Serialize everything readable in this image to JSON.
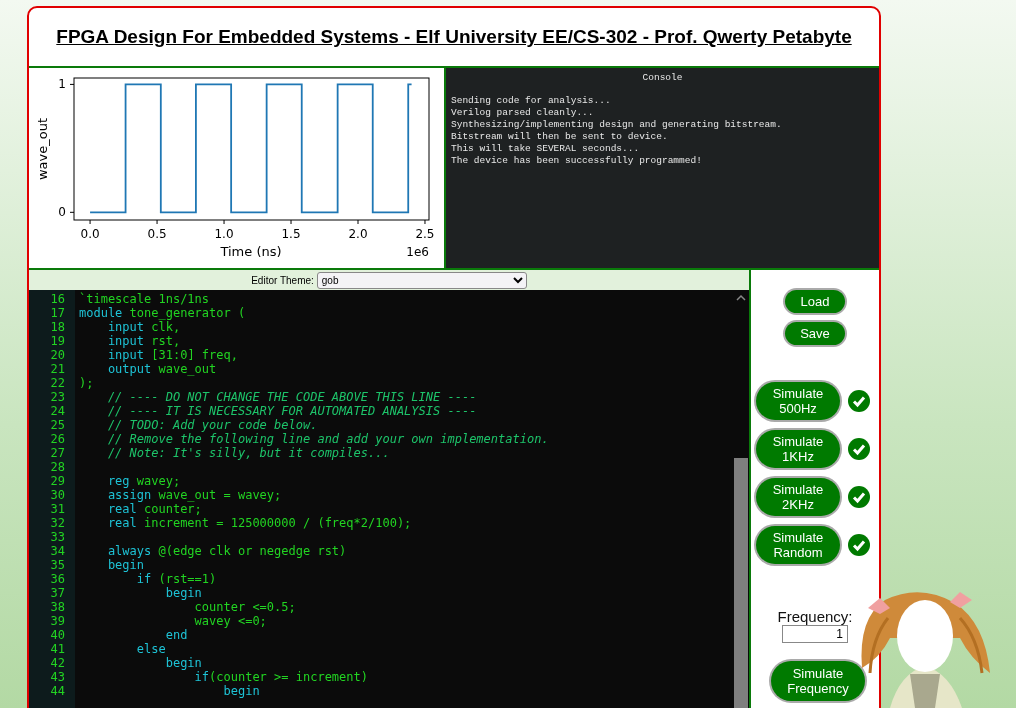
{
  "header": {
    "title": "FPGA Design For Embedded Systems - Elf University EE/CS-302 - Prof. Qwerty Petabyte"
  },
  "plot": {
    "chart_data": {
      "type": "line",
      "xlabel": "Time (ns)",
      "ylabel": "wave_out",
      "x": [
        0,
        0.265,
        0.265,
        0.528,
        0.528,
        0.79,
        0.79,
        1.053,
        1.053,
        1.318,
        1.318,
        1.58,
        1.58,
        1.848,
        1.848,
        2.11,
        2.11,
        2.375,
        2.375,
        2.4
      ],
      "series": [
        {
          "color": "#1f77b4",
          "values": [
            0,
            0,
            1,
            1,
            0,
            0,
            1,
            1,
            0,
            0,
            1,
            1,
            0,
            0,
            1,
            1,
            0,
            0,
            1,
            1
          ]
        }
      ],
      "xticks": [
        {
          "value": 0,
          "label": "0.0"
        },
        {
          "value": 0.5,
          "label": "0.5"
        },
        {
          "value": 1,
          "label": "1.0"
        },
        {
          "value": 1.5,
          "label": "1.5"
        },
        {
          "value": 2,
          "label": "2.0"
        },
        {
          "value": 2.5,
          "label": "2.5"
        }
      ],
      "yticks": [
        0,
        1
      ],
      "xlim": [
        -0.12,
        2.53
      ],
      "ylim": [
        -0.06,
        1.05
      ],
      "annotations": [
        "1e6"
      ]
    }
  },
  "console": {
    "title": "Console",
    "lines": [
      "Sending code for analysis...",
      "Verilog parsed cleanly...",
      "Synthesizing/implementing design and generating bitstream.",
      "Bitstream will then be sent to device.",
      "This will take SEVERAL seconds...",
      "The device has been successfully programmed!"
    ]
  },
  "editor": {
    "theme_label": "Editor Theme:",
    "theme": "gob",
    "lines": [
      {
        "number": "16",
        "segments": [
          {
            "kind": "plain",
            "text": "`timescale 1ns/1ns"
          }
        ]
      },
      {
        "number": "17",
        "segments": [
          {
            "kind": "keyword",
            "text": "module"
          },
          {
            "kind": "plain",
            "text": " tone_generator ("
          }
        ]
      },
      {
        "number": "18",
        "segments": [
          {
            "kind": "keyword",
            "text": "    input"
          },
          {
            "kind": "plain",
            "text": " clk,"
          }
        ]
      },
      {
        "number": "19",
        "segments": [
          {
            "kind": "keyword",
            "text": "    input"
          },
          {
            "kind": "plain",
            "text": " rst,"
          }
        ]
      },
      {
        "number": "20",
        "segments": [
          {
            "kind": "keyword",
            "text": "    input"
          },
          {
            "kind": "plain",
            "text": " [31:0] freq,"
          }
        ]
      },
      {
        "number": "21",
        "segments": [
          {
            "kind": "keyword",
            "text": "    output"
          },
          {
            "kind": "plain",
            "text": " wave_out"
          }
        ]
      },
      {
        "number": "22",
        "segments": [
          {
            "kind": "plain",
            "text": ");"
          }
        ]
      },
      {
        "number": "23",
        "segments": [
          {
            "kind": "comment",
            "text": "    // ---- DO NOT CHANGE THE CODE ABOVE THIS LINE ----"
          }
        ]
      },
      {
        "number": "24",
        "segments": [
          {
            "kind": "comment",
            "text": "    // ---- IT IS NECESSARY FOR AUTOMATED ANALYSIS ----"
          }
        ]
      },
      {
        "number": "25",
        "segments": [
          {
            "kind": "comment",
            "text": "    // TODO: Add your code below."
          }
        ]
      },
      {
        "number": "26",
        "segments": [
          {
            "kind": "comment",
            "text": "    // Remove the following line and add your own implementation."
          }
        ]
      },
      {
        "number": "27",
        "segments": [
          {
            "kind": "comment",
            "text": "    // Note: It's silly, but it compiles..."
          }
        ]
      },
      {
        "number": "28"
      },
      {
        "number": "29",
        "segments": [
          {
            "kind": "keyword",
            "text": "    reg"
          },
          {
            "kind": "plain",
            "text": " wavey;"
          }
        ]
      },
      {
        "number": "30",
        "segments": [
          {
            "kind": "keyword",
            "text": "    assign"
          },
          {
            "kind": "plain",
            "text": " wave_out = wavey;"
          }
        ]
      },
      {
        "number": "31",
        "segments": [
          {
            "kind": "keyword",
            "text": "    real"
          },
          {
            "kind": "plain",
            "text": " counter;"
          }
        ]
      },
      {
        "number": "32",
        "segments": [
          {
            "kind": "keyword",
            "text": "    real"
          },
          {
            "kind": "plain",
            "text": " increment = 125000000 / (freq*2/100);"
          }
        ]
      },
      {
        "number": "33"
      },
      {
        "number": "34",
        "segments": [
          {
            "kind": "keyword",
            "text": "    always"
          },
          {
            "kind": "plain",
            "text": " @(edge clk or negedge rst)"
          }
        ]
      },
      {
        "number": "35",
        "segments": [
          {
            "kind": "keyword",
            "text": "    begin"
          }
        ]
      },
      {
        "number": "36",
        "segments": [
          {
            "kind": "keyword",
            "text": "        if"
          },
          {
            "kind": "plain",
            "text": " (rst==1)"
          }
        ]
      },
      {
        "number": "37",
        "segments": [
          {
            "kind": "keyword",
            "text": "            begin"
          }
        ]
      },
      {
        "number": "38",
        "segments": [
          {
            "kind": "plain",
            "text": "                counter <=0.5;"
          }
        ]
      },
      {
        "number": "39",
        "segments": [
          {
            "kind": "plain",
            "text": "                wavey <=0;"
          }
        ]
      },
      {
        "number": "40",
        "segments": [
          {
            "kind": "keyword",
            "text": "            end"
          }
        ]
      },
      {
        "number": "41",
        "segments": [
          {
            "kind": "keyword",
            "text": "        else"
          }
        ]
      },
      {
        "number": "42",
        "segments": [
          {
            "kind": "keyword",
            "text": "            begin"
          }
        ]
      },
      {
        "number": "43",
        "segments": [
          {
            "kind": "keyword",
            "text": "                if"
          },
          {
            "kind": "plain",
            "text": "(counter >= increment)"
          }
        ]
      },
      {
        "number": "44",
        "segments": [
          {
            "kind": "keyword",
            "text": "                    begin"
          }
        ]
      }
    ]
  },
  "controls": {
    "file_buttons": [
      "Load",
      "Save"
    ],
    "simulations": [
      {
        "label": "Simulate 500Hz",
        "passed": true
      },
      {
        "label": "Simulate 1KHz",
        "passed": true
      },
      {
        "label": "Simulate 2KHz",
        "passed": true
      },
      {
        "label": "Simulate Random",
        "passed": true
      }
    ],
    "frequency_label": "Frequency:",
    "frequency_value": "1",
    "simulate_frequency": "Simulate Frequency"
  }
}
